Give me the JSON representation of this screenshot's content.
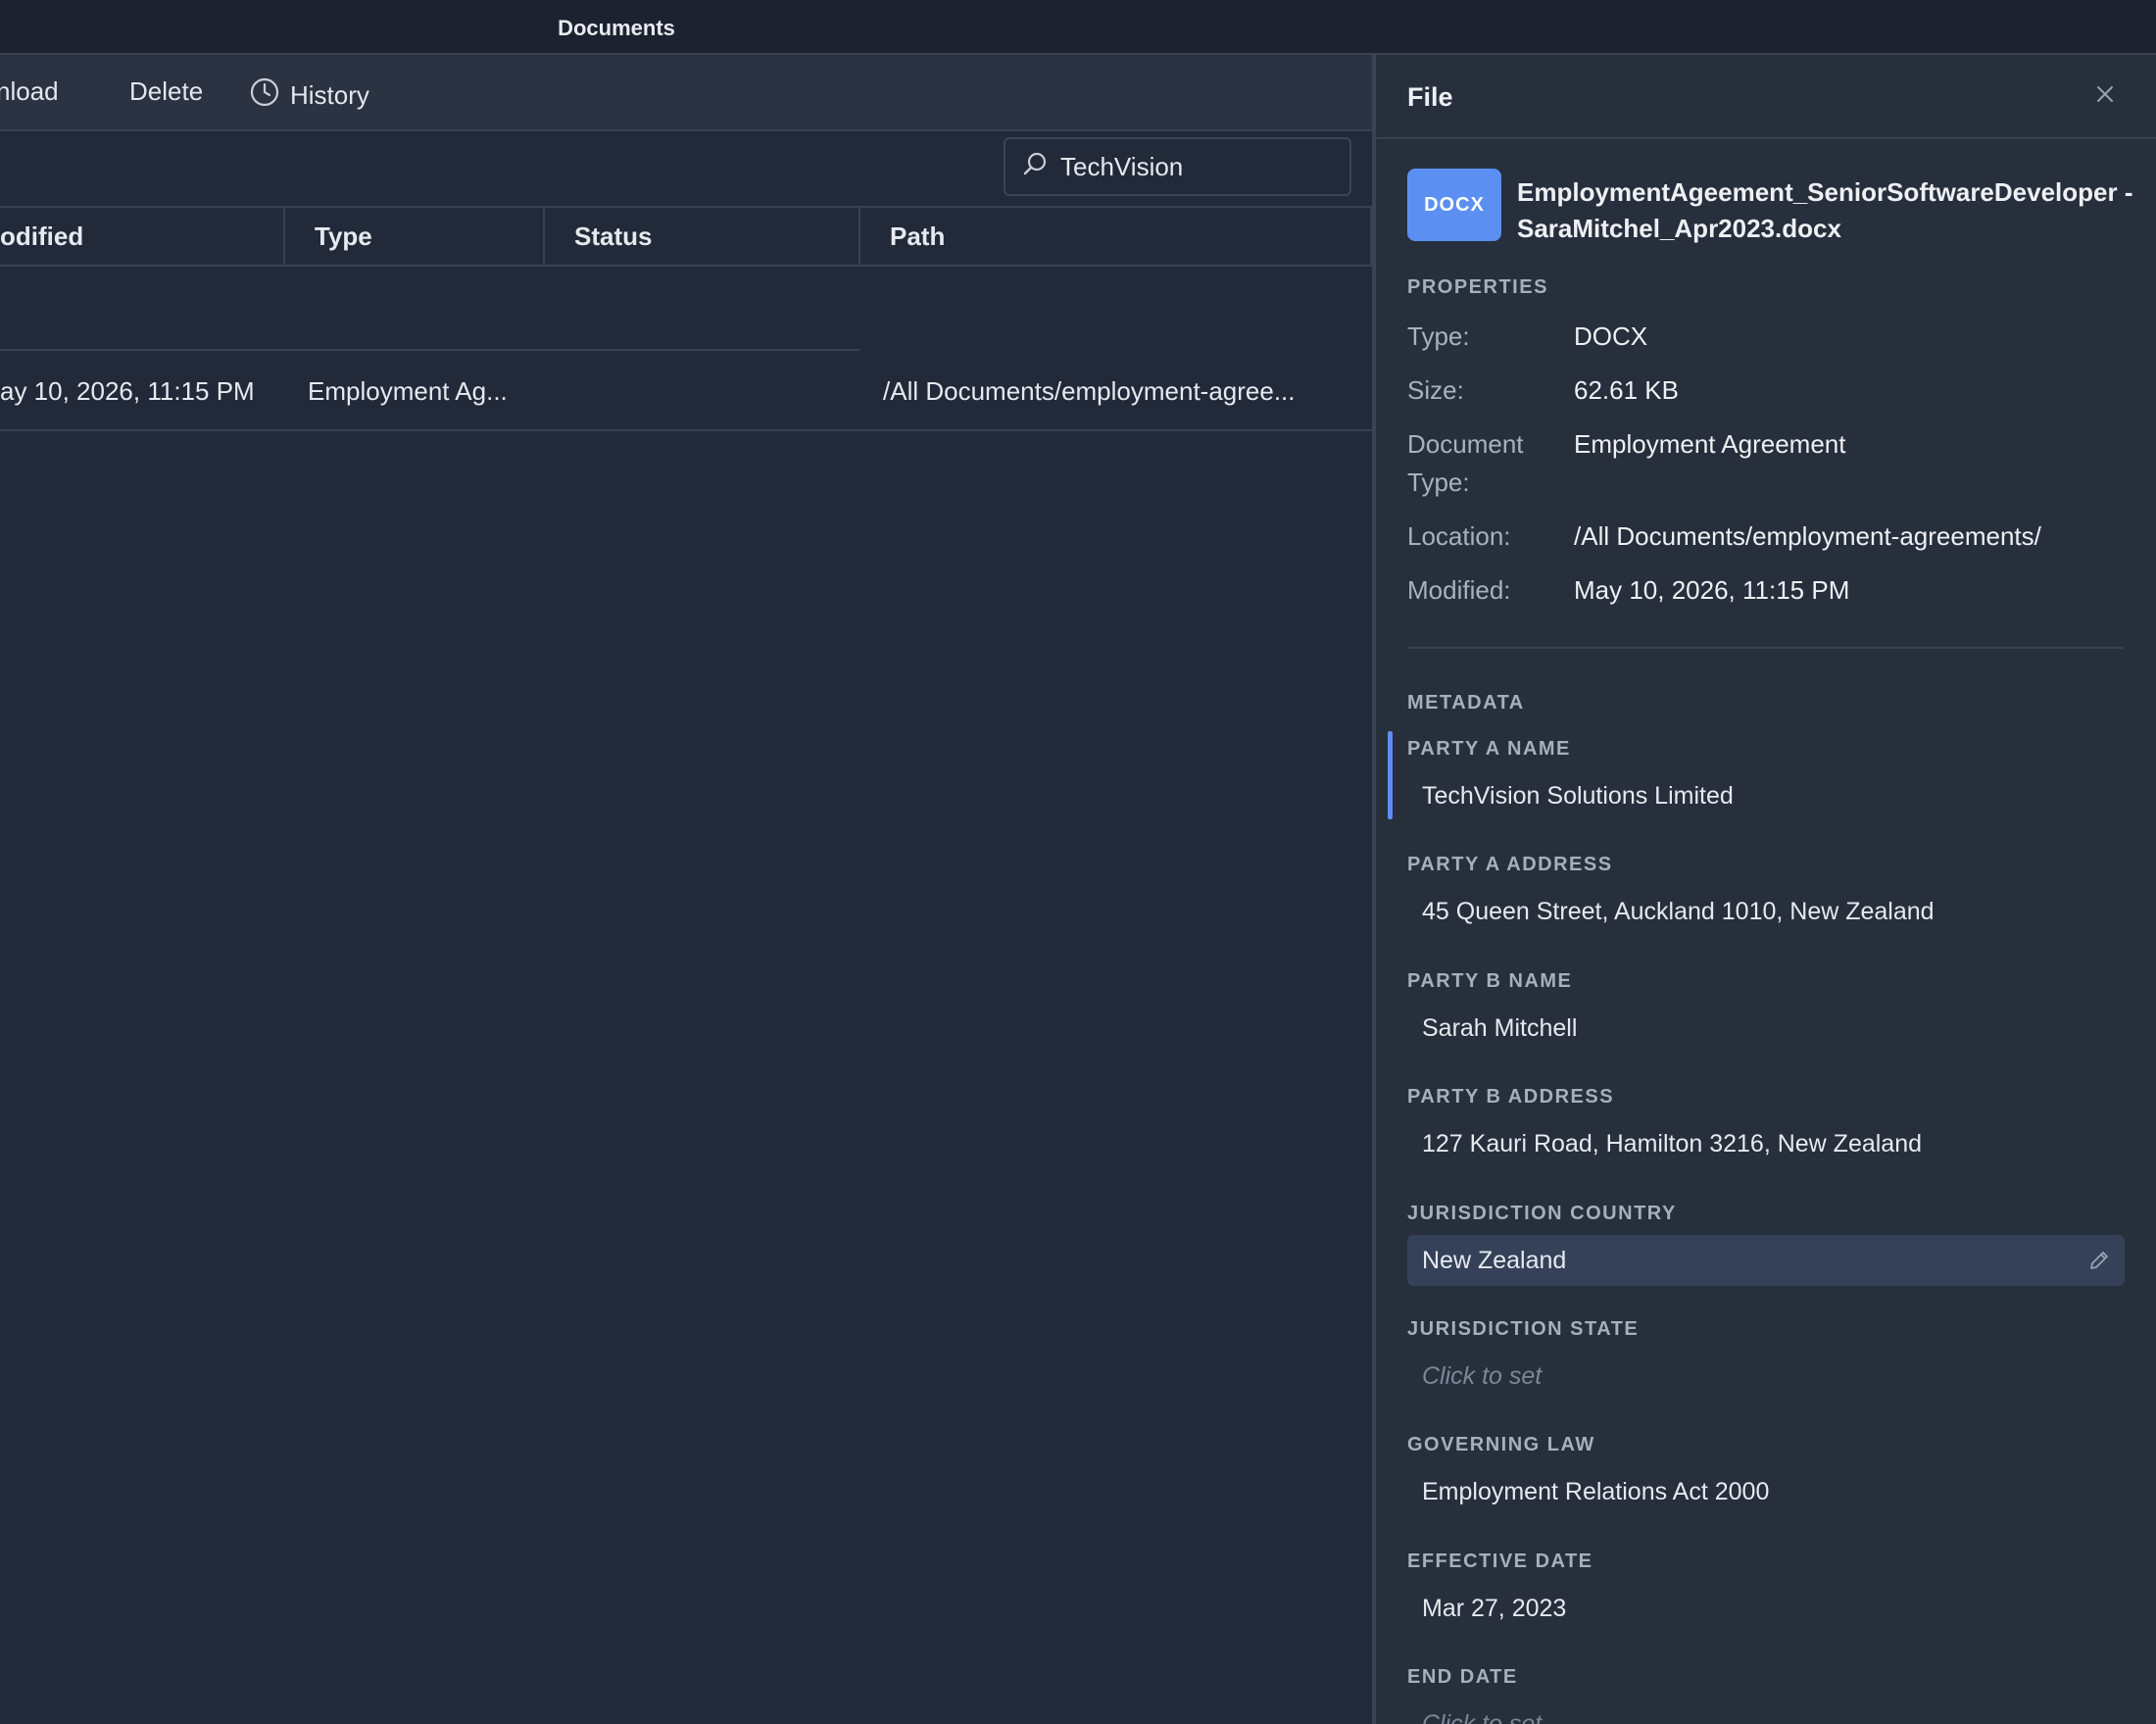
{
  "window": {
    "title": "Documents"
  },
  "toolbar": {
    "download_label": "nload",
    "delete_label": "Delete",
    "history_label": "History"
  },
  "search": {
    "value": "TechVision"
  },
  "table": {
    "columns": [
      "odified",
      "Type",
      "Status",
      "Path"
    ],
    "rows": [
      {
        "modified": "ay 10, 2026, 11:15 PM",
        "type": "Employment Ag...",
        "status": "",
        "path": "/All Documents/employment-agree..."
      }
    ]
  },
  "panel": {
    "title": "File",
    "badge": "DOCX",
    "file_name": "EmploymentAgeement_SeniorSoftwareDeveloper - SaraMitchel_Apr2023.docx",
    "properties_label": "PROPERTIES",
    "properties": {
      "type_k": "Type:",
      "type_v": "DOCX",
      "size_k": "Size:",
      "size_v": "62.61 KB",
      "doctype_k": "Document Type:",
      "doctype_v": "Employment Agreement",
      "location_k": "Location:",
      "location_v": "/All Documents/employment-agreements/",
      "modified_k": "Modified:",
      "modified_v": "May 10, 2026, 11:15 PM"
    },
    "metadata_label": "METADATA",
    "metadata": [
      {
        "label": "PARTY A NAME",
        "value": "TechVision Solutions Limited"
      },
      {
        "label": "PARTY A ADDRESS",
        "value": "45 Queen Street, Auckland 1010, New Zealand"
      },
      {
        "label": "PARTY B NAME",
        "value": "Sarah Mitchell"
      },
      {
        "label": "PARTY B ADDRESS",
        "value": "127 Kauri Road, Hamilton 3216, New Zealand"
      },
      {
        "label": "JURISDICTION COUNTRY",
        "value": "New Zealand"
      },
      {
        "label": "JURISDICTION STATE",
        "value": "Click to set"
      },
      {
        "label": "GOVERNING LAW",
        "value": "Employment Relations Act 2000"
      },
      {
        "label": "EFFECTIVE DATE",
        "value": "Mar 27, 2023"
      },
      {
        "label": "END DATE",
        "value": "Click to set"
      }
    ]
  },
  "colors": {
    "accent": "#5b8ff2",
    "background": "#222938",
    "panel": "#272e3c",
    "active_field": "#344159"
  }
}
